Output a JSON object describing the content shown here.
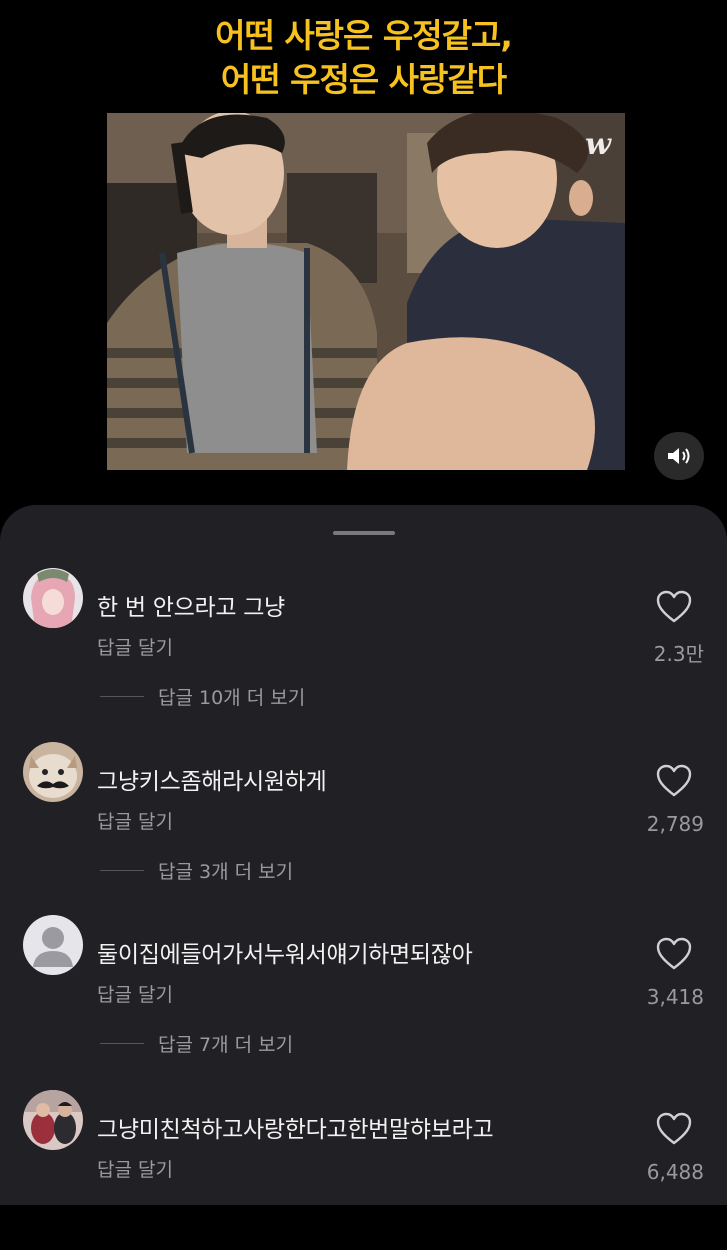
{
  "video": {
    "caption_line1": "어떤 사랑은 우정같고,",
    "caption_line2": "어떤 우정은 사랑같다",
    "watermark": "w",
    "sound_icon": "speaker-icon"
  },
  "colors": {
    "caption": "#f7c21e",
    "sheet_bg": "#212125",
    "text_primary": "#f2f2f2",
    "text_secondary": "#9a9a9e"
  },
  "comments": [
    {
      "text": "한 번 안으라고 그냥",
      "reply": "답글 달기",
      "more_replies": "답글 10개 더 보기",
      "likes": "2.3만"
    },
    {
      "text": "그냥키스좀해라시원하게",
      "reply": "답글 달기",
      "more_replies": "답글 3개 더 보기",
      "likes": "2,789"
    },
    {
      "text": "둘이집에들어가서누워서얘기하면되잖아",
      "reply": "답글 달기",
      "more_replies": "답글 7개 더 보기",
      "likes": "3,418"
    },
    {
      "text": "그냥미친척하고사랑한다고한번말햐보라고",
      "reply": "답글 달기",
      "likes": "6,488"
    }
  ]
}
